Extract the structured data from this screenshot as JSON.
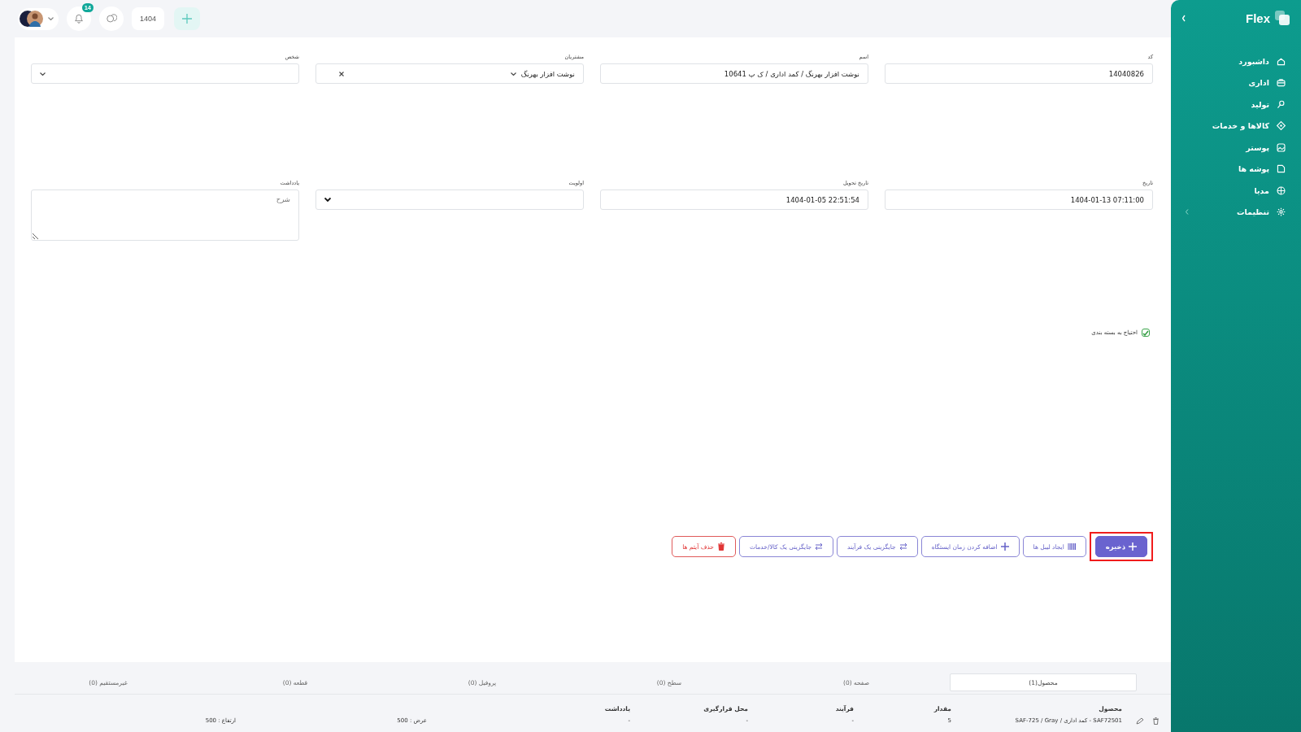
{
  "topbar": {
    "notification_count": "14",
    "year": "1404"
  },
  "sidebar": {
    "brand": "Flex",
    "items": [
      {
        "label": "داشبورد",
        "has_submenu": false
      },
      {
        "label": "اداری",
        "has_submenu": false
      },
      {
        "label": "تولید",
        "has_submenu": false
      },
      {
        "label": "کالاها و خدمات",
        "has_submenu": false
      },
      {
        "label": "پوستر",
        "has_submenu": false
      },
      {
        "label": "پوشه ها",
        "has_submenu": false
      },
      {
        "label": "مدیا",
        "has_submenu": false
      },
      {
        "label": "تنظیمات",
        "has_submenu": true
      }
    ]
  },
  "form": {
    "rows": [
      [
        {
          "label": "کد",
          "kind": "text",
          "value": "14040826"
        },
        {
          "label": "اسم",
          "kind": "text",
          "value": "نوشت افزار بهرنگ / کمد اداری / ک پ 10641"
        },
        {
          "label": "مشتریان",
          "kind": "select",
          "value": "نوشت افزار بهرنگ",
          "clearable": true
        },
        {
          "label": "شخص",
          "kind": "select",
          "clearable": false
        }
      ],
      [
        {
          "label": "تاریخ",
          "kind": "text",
          "value": "1404-01-13 07:11:00"
        },
        {
          "label": "تاریخ تحویل",
          "kind": "text",
          "value": "1404-01-05 22:51:54"
        },
        {
          "label": "اولویت",
          "kind": "native-select"
        },
        {
          "label": "یادداشت",
          "kind": "textarea",
          "placeholder": "شرح"
        }
      ]
    ],
    "checkbox": {
      "label": "احتیاج به بسته بندی",
      "checked": true
    },
    "buttons": [
      {
        "label": "ذخیره",
        "kind": "primary",
        "highlighted": true
      },
      {
        "label": "ایجاد لیبل ها",
        "kind": "outline",
        "highlighted": false
      },
      {
        "label": "اضافه کردن زمان ایستگاه",
        "kind": "outline",
        "highlighted": false
      },
      {
        "label": "جایگزینی یک فرآیند",
        "kind": "outline",
        "highlighted": false
      },
      {
        "label": "جایگزینی یک کالا/خدمات",
        "kind": "outline",
        "highlighted": false
      },
      {
        "label": "حذف آیتم ها",
        "kind": "danger",
        "highlighted": false
      }
    ]
  },
  "tabs": [
    {
      "label": "محصول(1)",
      "selected": true
    },
    {
      "label": "صفحه (0)",
      "selected": false
    },
    {
      "label": "سطح (0)",
      "selected": false
    },
    {
      "label": "پروفیل (0)",
      "selected": false
    },
    {
      "label": "قطعه (0)",
      "selected": false
    },
    {
      "label": "غیرمستقیم (0)",
      "selected": false
    }
  ],
  "table": {
    "columns": [
      "محصول",
      "مقدار",
      "فرآیند",
      "محل قرارگیری",
      "یادداشت"
    ],
    "rows": [
      [
        "SAF72501 - کمد اداری / SAF-725 / Gray",
        "5",
        "-",
        "-",
        "-",
        "عرض : 500",
        "ارتفاع : 500"
      ]
    ]
  }
}
